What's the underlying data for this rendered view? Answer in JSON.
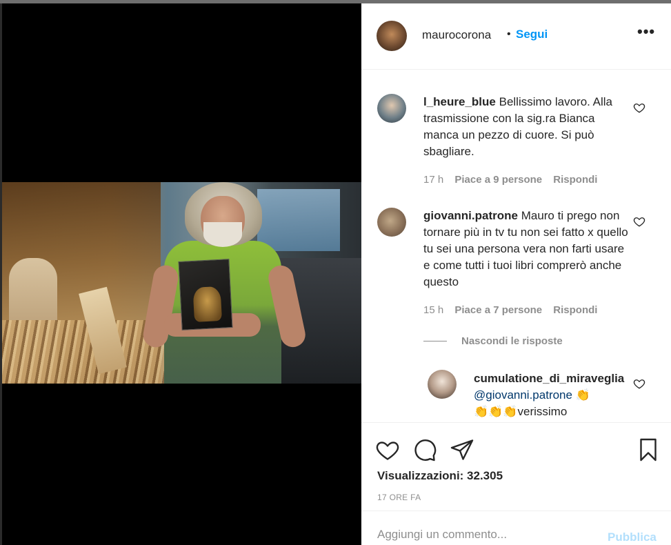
{
  "post": {
    "author": "maurocorona",
    "separator": "•",
    "follow_label": "Segui",
    "more_label": "•••",
    "views_label": "Visualizzazioni: 32.305",
    "time_label": "17 ORE FA"
  },
  "comments": [
    {
      "username": "l_heure_blue",
      "text": "Bellissimo lavoro. Alla trasmissione con la sig.ra Bianca manca un pezzo di cuore. Si può sbagliare.",
      "age": "17 h",
      "likes": "Piace a 9 persone",
      "reply_label": "Rispondi"
    },
    {
      "username": "giovanni.patrone",
      "text": "Mauro ti prego non tornare più in tv tu non sei fatto x quello tu sei una persona vera non farti usare e come tutti i tuoi libri comprerò anche questo",
      "age": "15 h",
      "likes": "Piace a 7 persone",
      "reply_label": "Rispondi"
    }
  ],
  "replies": {
    "toggle_label": "Nascondi le risposte",
    "items": [
      {
        "username": "cumulatione_di_miraveglia",
        "mention": "@giovanni.patrone",
        "emoji_a": "👏",
        "emoji_b": "👏👏👏",
        "text": "verissimo"
      }
    ]
  },
  "compose": {
    "placeholder": "Aggiungi un commento...",
    "publish_label": "Pubblica"
  },
  "colors": {
    "accent": "#0095f6",
    "publish_disabled": "#b2dffc",
    "muted": "#8e8e8e",
    "text": "#262626"
  },
  "icons": [
    "heart-icon",
    "comment-icon",
    "share-icon",
    "bookmark-icon",
    "more-icon"
  ]
}
